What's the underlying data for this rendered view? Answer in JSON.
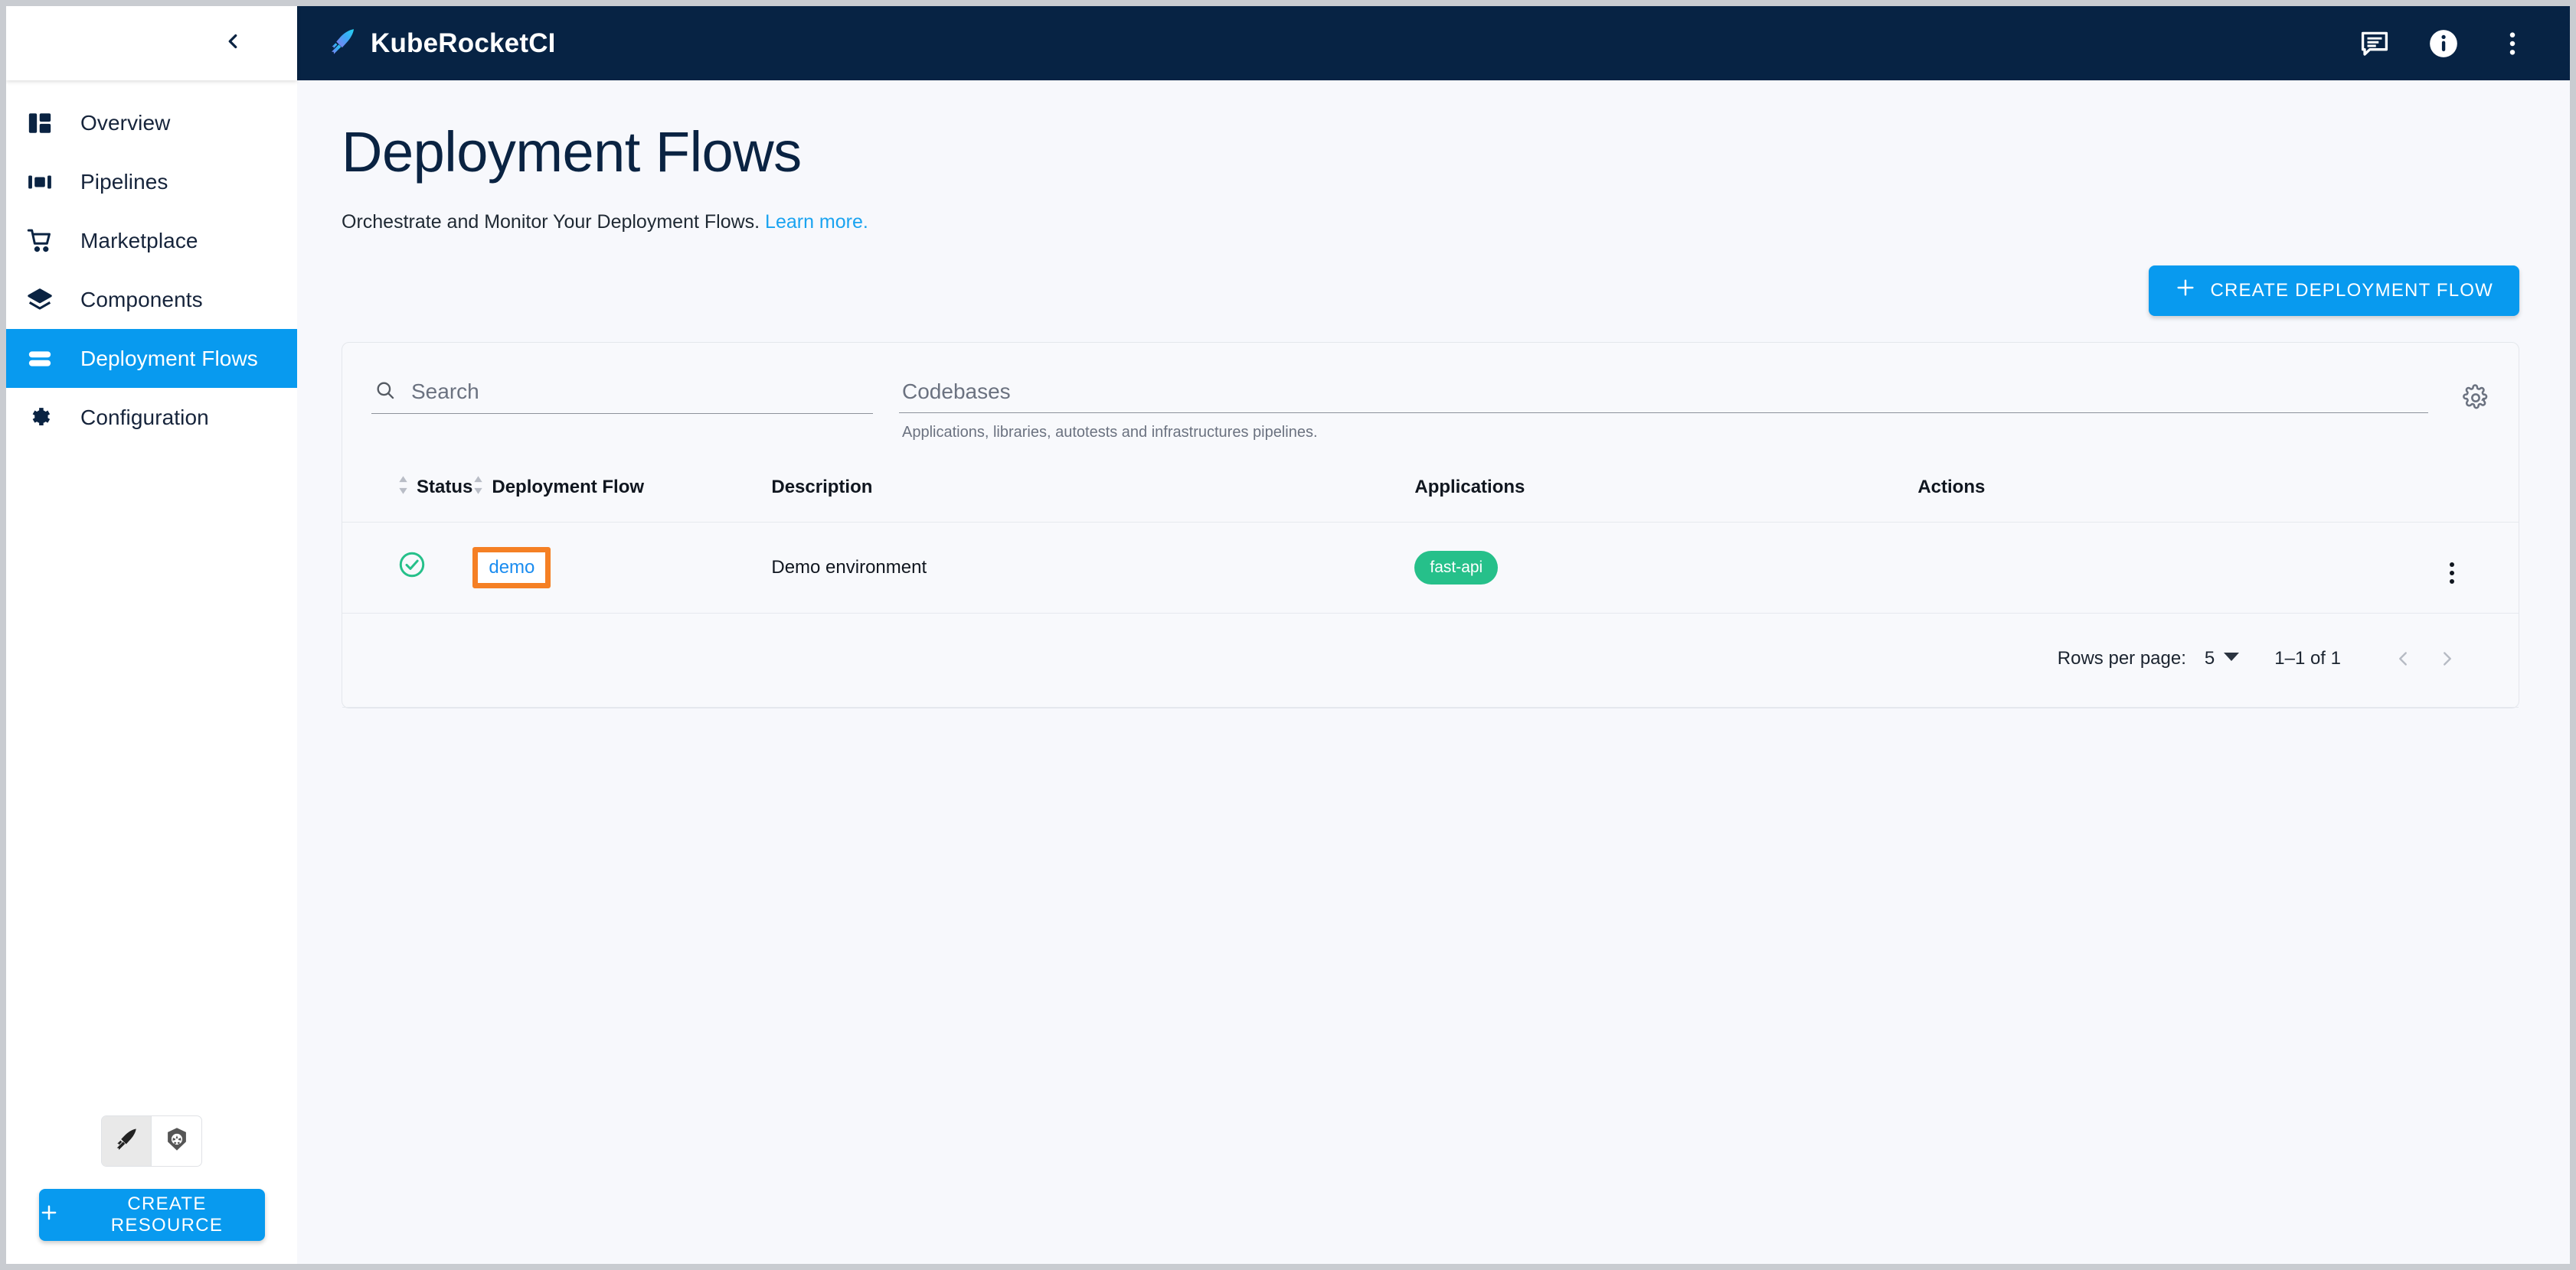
{
  "sidebar": {
    "collapse_icon": "chevron-left-icon",
    "items": [
      {
        "label": "Overview",
        "icon": "dashboard-icon",
        "active": false
      },
      {
        "label": "Pipelines",
        "icon": "pipelines-icon",
        "active": false
      },
      {
        "label": "Marketplace",
        "icon": "shopping-cart-icon",
        "active": false
      },
      {
        "label": "Components",
        "icon": "layers-icon",
        "active": false
      },
      {
        "label": "Deployment Flows",
        "icon": "deployment-flows-icon",
        "active": true
      },
      {
        "label": "Configuration",
        "icon": "gear-icon",
        "active": false
      }
    ],
    "cluster_toggle": {
      "option_krci": "kuberocketci-icon",
      "option_k8s": "kubernetes-icon"
    },
    "create_resource_label": "CREATE RESOURCE"
  },
  "topbar": {
    "brand": "KubeRocketCI",
    "logo_icon": "rocket-icon",
    "actions": [
      {
        "icon": "chat-icon"
      },
      {
        "icon": "info-icon"
      },
      {
        "icon": "kebab-menu-icon"
      }
    ]
  },
  "page": {
    "title": "Deployment Flows",
    "subtitle": "Orchestrate and Monitor Your Deployment Flows.",
    "learn_more": "Learn more.",
    "create_button": "CREATE DEPLOYMENT FLOW"
  },
  "filters": {
    "search_placeholder": "Search",
    "search_value": "",
    "search_icon": "search-icon",
    "codebases_label": "Codebases",
    "codebases_value": "",
    "codebases_helper": "Applications, libraries, autotests and infrastructures pipelines.",
    "settings_icon": "gear-icon"
  },
  "table": {
    "columns": [
      {
        "label": "Status",
        "sortable": true
      },
      {
        "label": "Deployment Flow",
        "sortable": true
      },
      {
        "label": "Description",
        "sortable": false
      },
      {
        "label": "Applications",
        "sortable": false
      },
      {
        "label": "Actions",
        "sortable": false
      }
    ],
    "rows": [
      {
        "status_icon": "check-circle-icon",
        "status_color": "#26c08a",
        "name": "demo",
        "description": "Demo environment",
        "applications": [
          "fast-api"
        ],
        "actions_icon": "kebab-menu-icon"
      }
    ]
  },
  "pagination": {
    "rows_per_page_label": "Rows per page:",
    "rows_per_page_value": "5",
    "range_text": "1–1 of 1",
    "prev_icon": "chevron-left-icon",
    "next_icon": "chevron-right-icon"
  },
  "colors": {
    "accent": "#089aef",
    "navy": "#072344",
    "success": "#26c08a",
    "highlight": "#f58024",
    "link": "#1a8cf0"
  }
}
